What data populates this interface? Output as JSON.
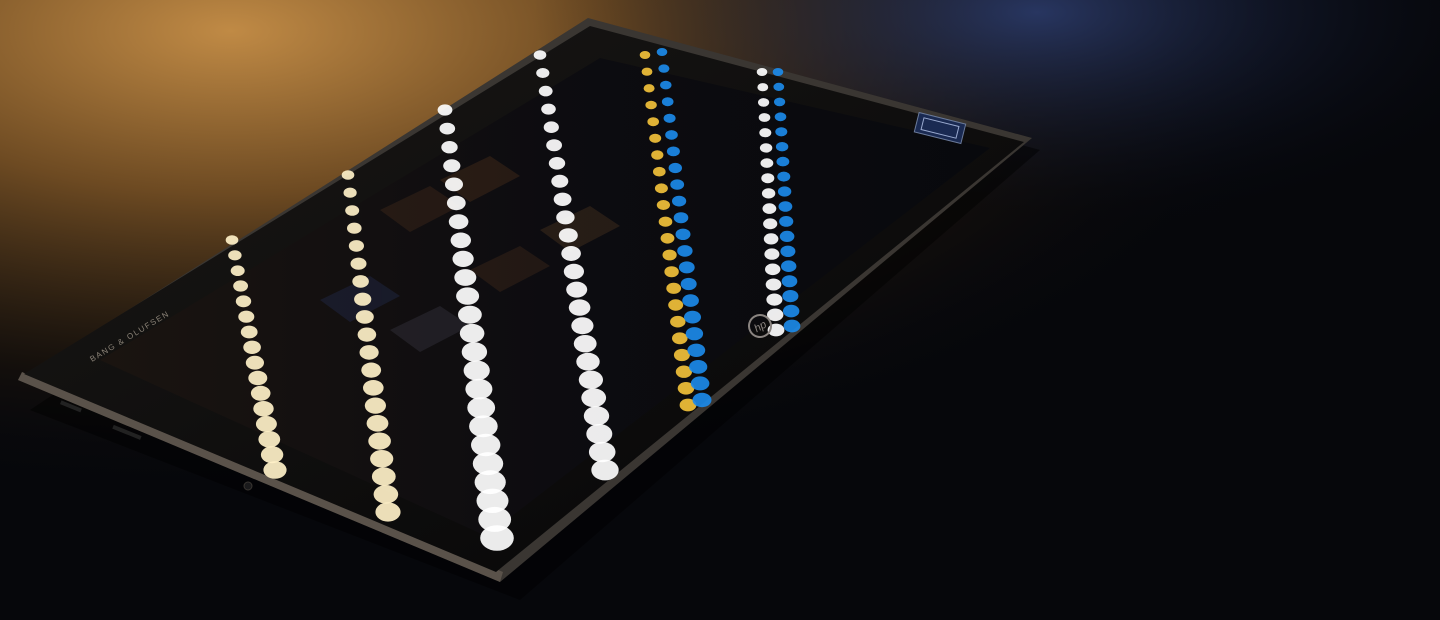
{
  "photo": {
    "subject": "tablet-on-dark-surface",
    "brand_logo": "hp",
    "bezel_text": "BANG & OLUFSEN",
    "processor_badge": "intel-core-badge",
    "colors": {
      "surface_warm": "#b07a3a",
      "surface_dark": "#07080d",
      "surface_blue": "#1e2c52",
      "bezel": "#0b0b0e",
      "frame": "#3a3632",
      "screen": "#0e0c10",
      "reflection_warm": "#fff1c8",
      "reflection_white": "#ffffff",
      "reflection_gold": "#f2c13a",
      "reflection_blue": "#1c8ae8"
    }
  }
}
